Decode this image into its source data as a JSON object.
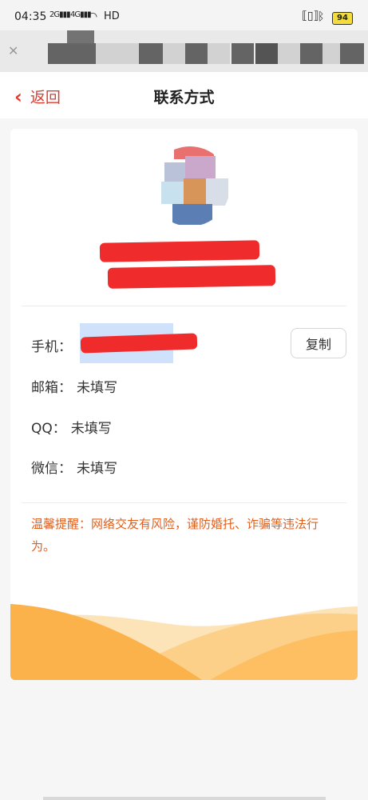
{
  "status_bar": {
    "time": "04:35",
    "network_1": "2G",
    "network_2": "4G",
    "hd": "HD",
    "battery": "94"
  },
  "nav": {
    "back_label": "返回",
    "title": "联系方式"
  },
  "contact": {
    "phone_label": "手机：",
    "copy_label": "复制",
    "email_label": "邮箱：",
    "email_value": "未填写",
    "qq_label": "QQ：",
    "qq_value": "未填写",
    "wechat_label": "微信：",
    "wechat_value": "未填写"
  },
  "tip": "温馨提醒：网络交友有风险，谨防婚托、诈骗等违法行为。",
  "colors": {
    "accent": "#e23b2e",
    "tip": "#e0601f",
    "wave_light": "#fdd8a0",
    "wave_dark": "#fbb24a"
  }
}
